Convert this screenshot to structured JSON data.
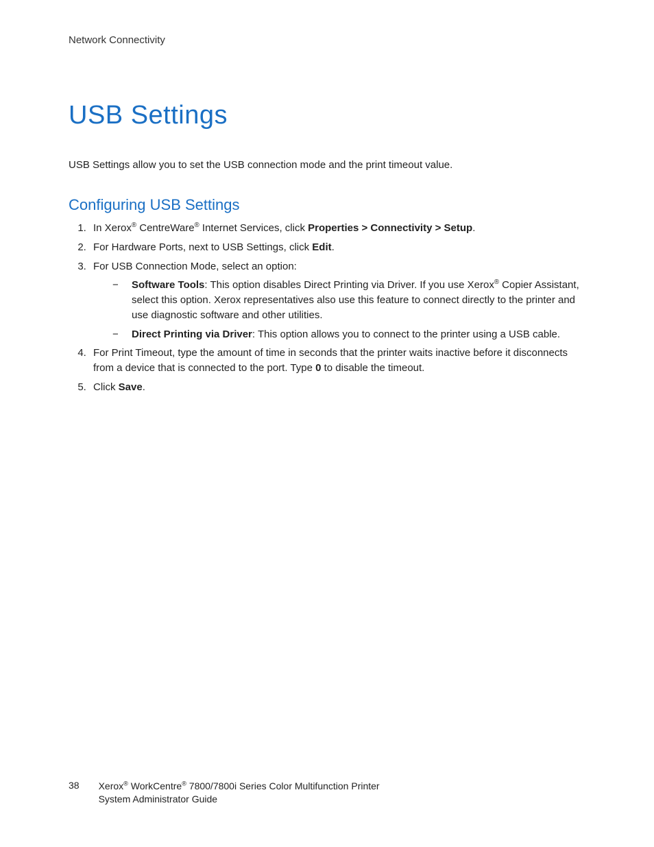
{
  "header": {
    "section": "Network Connectivity"
  },
  "title": "USB Settings",
  "intro": "USB Settings allow you to set the USB connection mode and the print timeout value.",
  "subheading": "Configuring USB Settings",
  "steps": {
    "s1": {
      "pre": "In Xerox",
      "mid1": " CentreWare",
      "mid2": " Internet Services, click ",
      "bold": "Properties > Connectivity > Setup",
      "post": "."
    },
    "s2": {
      "pre": "For Hardware Ports, next to USB Settings, click ",
      "bold": "Edit",
      "post": "."
    },
    "s3": {
      "text": "For USB Connection Mode, select an option:",
      "sub1": {
        "bold": "Software Tools",
        "mid1": ": This option disables Direct Printing via Driver. If you use Xerox",
        "mid2": " Copier Assistant, select this option. Xerox representatives also use this feature to connect directly to the printer and use diagnostic software and other utilities."
      },
      "sub2": {
        "bold": "Direct Printing via Driver",
        "post": ": This option allows you to connect to the printer using a USB cable."
      }
    },
    "s4": {
      "pre": "For Print Timeout, type the amount of time in seconds that the printer waits inactive before it disconnects from a device that is connected to the port. Type ",
      "bold": "0",
      "post": " to disable the timeout."
    },
    "s5": {
      "pre": "Click ",
      "bold": "Save",
      "post": "."
    }
  },
  "footer": {
    "page_number": "38",
    "line1_pre": "Xerox",
    "line1_mid": " WorkCentre",
    "line1_post": " 7800/7800i Series Color Multifunction Printer",
    "line2": "System Administrator Guide"
  },
  "reg": "®"
}
